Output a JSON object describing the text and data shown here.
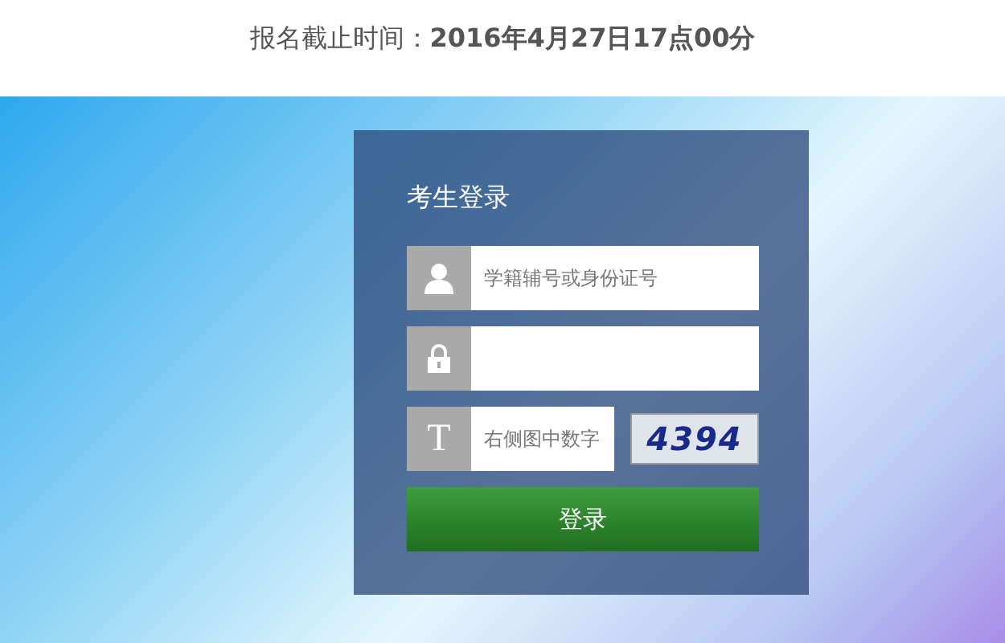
{
  "deadline": {
    "label": "报名截止时间：",
    "value": "2016年4月27日17点00分"
  },
  "login": {
    "title": "考生登录",
    "fields": [
      {
        "kind": "user",
        "placeholder": "学籍辅号或身份证号"
      },
      {
        "kind": "lock"
      },
      {
        "kind": "captcha",
        "icon_text": "T",
        "placeholder": "右侧图中数字",
        "captcha": "4394"
      }
    ],
    "button": "登录"
  }
}
